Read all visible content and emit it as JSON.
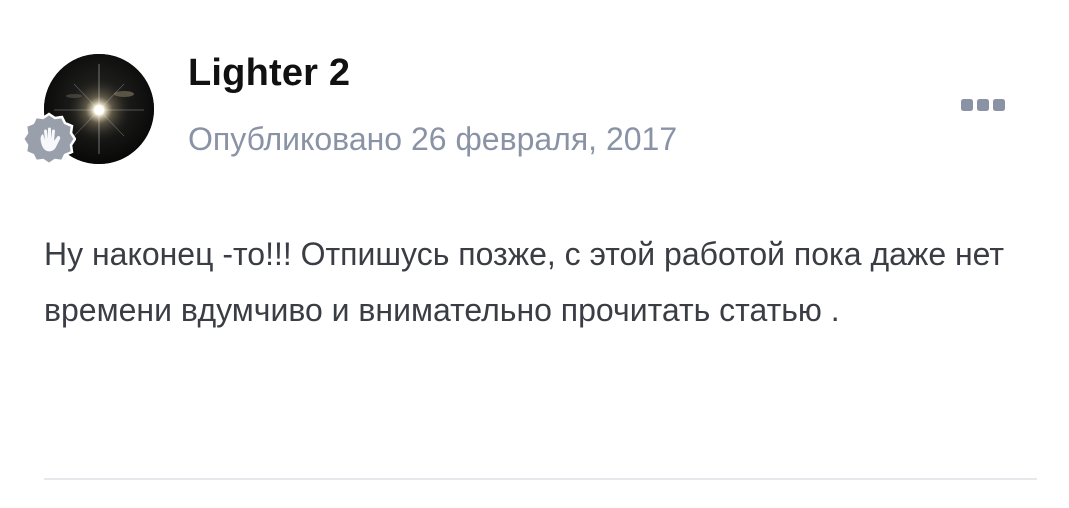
{
  "post": {
    "author": "Lighter 2",
    "published": "Опубликовано 26 февраля, 2017",
    "body": "Ну наконец -то!!! Отпишусь позже, с этой работой пока даже нет времени вдумчиво и внимательно прочитать статью ."
  },
  "icons": {
    "avatar": "light-flare-avatar",
    "rank_badge": "waving-hand-badge-icon",
    "more": "ellipsis-icon"
  },
  "colors": {
    "author": "#111111",
    "meta": "#8a93a6",
    "body": "#3a3d44",
    "badge": "#9aa0ab",
    "more_icon": "#8a93a6",
    "divider": "#e6e8ec"
  }
}
